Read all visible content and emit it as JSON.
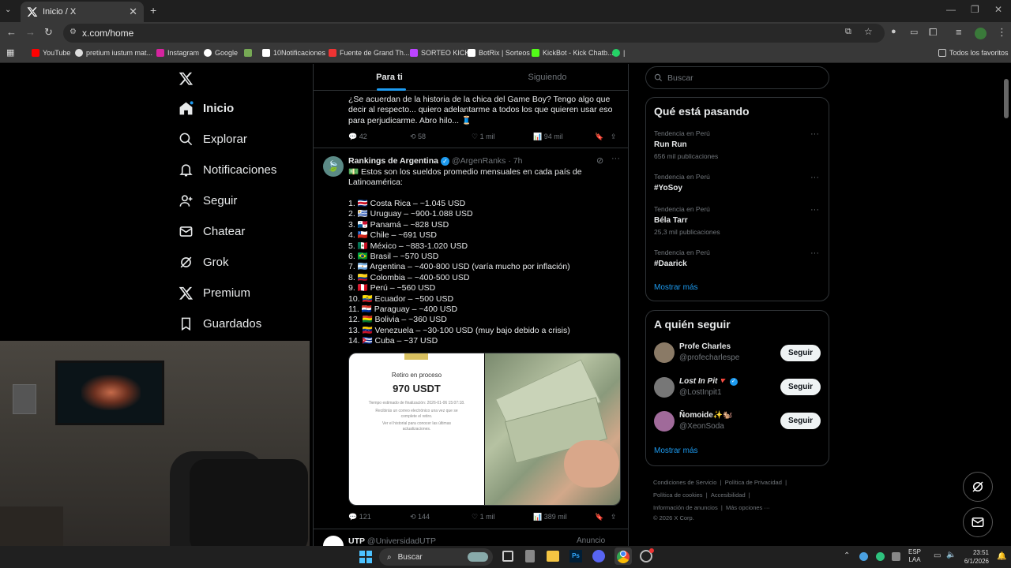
{
  "browser": {
    "tab_title": "Inicio / X",
    "url": "x.com/home",
    "bookmarks": [
      "YouTube",
      "pretium iustum mat...",
      "Instagram",
      "Google",
      "10Notificaciones",
      "Fuente de Grand Th...",
      "SORTEO KICK",
      "BotRix | Sorteos",
      "KickBot - Kick Chatb...",
      "|"
    ],
    "all_bookmarks": "Todos los favoritos"
  },
  "nav": {
    "items": [
      "Inicio",
      "Explorar",
      "Notificaciones",
      "Seguir",
      "Chatear",
      "Grok",
      "Premium",
      "Guardados"
    ]
  },
  "feed": {
    "tabs": [
      "Para ti",
      "Siguiendo"
    ],
    "tweet1": {
      "text": "¿Se acuerdan de la historia de la chica del Game Boy?  Tengo algo que decir al respecto... quiero adelantarme a todos los que quieren usar eso para perjudicarme. Abro hilo... 🧵",
      "replies": "42",
      "retweets": "58",
      "likes": "1 mil",
      "views": "94 mil"
    },
    "tweet2": {
      "name": "Rankings de Argentina",
      "handle": "@ArgenRanks",
      "time": "· 7h",
      "intro": "💵 Estos son los sueldos promedio mensuales en cada país de Latinoamérica:",
      "list": [
        "1.  🇨🇷 Costa Rica – ~1.045 USD",
        "2.  🇺🇾 Uruguay – ~900-1.088 USD",
        "3.  🇵🇦 Panamá – ~828 USD",
        "4.  🇨🇱 Chile – ~691 USD",
        "5.  🇲🇽 México – ~883-1.020 USD",
        "6.  🇧🇷 Brasil – ~570 USD",
        "7.  🇦🇷 Argentina – ~400-800 USD (varía mucho por inflación)",
        "8.  🇨🇴 Colombia – ~400-500 USD",
        "9.  🇵🇪 Perú – ~560 USD",
        "10.  🇪🇨 Ecuador – ~500 USD",
        "11.  🇵🇾 Paraguay – ~400 USD",
        "12.  🇧🇴 Bolivia – ~360 USD",
        "13.  🇻🇪 Venezuela – ~30-100 USD (muy bajo debido a crisis)",
        "14.  🇨🇺 Cuba – ~37 USD"
      ],
      "image_panel": {
        "title": "Retiro en proceso",
        "amount": "970 USDT",
        "line1": "Tiempo estimado de finalización: 2026-01-06 15:07:18.",
        "line2": "Recibirás un correo electrónico una vez que se complete el retiro.",
        "line3": "Ver el historial para conocer las últimas actualizaciones."
      },
      "replies": "121",
      "retweets": "144",
      "likes": "1 mil",
      "views": "389 mil"
    },
    "tweet3": {
      "name": "UTP",
      "handle": "@UniversidadUTP",
      "tag": "Anuncio"
    }
  },
  "right": {
    "search_placeholder": "Buscar",
    "trending_title": "Qué está pasando",
    "trends": [
      {
        "context": "Tendencia en Perú",
        "name": "Run Run",
        "count": "656 mil publicaciones"
      },
      {
        "context": "Tendencia en Perú",
        "name": "#YoSoy",
        "count": ""
      },
      {
        "context": "Tendencia en Perú",
        "name": "Béla Tarr",
        "count": "25,3 mil publicaciones"
      },
      {
        "context": "Tendencia en Perú",
        "name": "#Daarick",
        "count": ""
      }
    ],
    "show_more": "Mostrar más",
    "follow_title": "A quién seguir",
    "follow": [
      {
        "name": "Profe Charles",
        "handle": "@profecharlespe",
        "avatar_color": "#8a7a66"
      },
      {
        "name": "Lost In Pit🔻",
        "handle": "@LostInpit1",
        "avatar_color": "#777"
      },
      {
        "name": "Ñomoide✨🐿️",
        "handle": "@XeonSoda",
        "avatar_color": "#a06a9a"
      }
    ],
    "follow_button": "Seguir",
    "show_more2": "Mostrar más",
    "footer": [
      "Condiciones de Servicio",
      "|",
      "Política de Privacidad",
      "|",
      "Política de cookies",
      "|",
      "Accesibilidad",
      "|",
      "Información de anuncios",
      "|",
      "Más opciones ···",
      "© 2026 X Corp."
    ]
  },
  "taskbar": {
    "search": "Buscar",
    "lang1": "ESP",
    "lang2": "LAA",
    "time": "23:51",
    "date": "6/1/2026"
  },
  "colors": {
    "accent": "#1d9bf0",
    "bg": "#000000",
    "border": "#2f3336"
  }
}
